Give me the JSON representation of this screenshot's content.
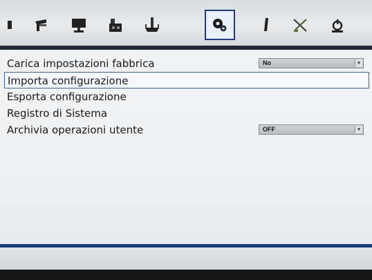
{
  "toolbar": {
    "icons": [
      {
        "name": "partial-icon"
      },
      {
        "name": "camera-icon"
      },
      {
        "name": "monitor-icon"
      },
      {
        "name": "network-icon"
      },
      {
        "name": "storage-icon"
      },
      {
        "name": "system-settings-icon",
        "active": true
      },
      {
        "name": "usb-icon"
      },
      {
        "name": "tools-icon"
      },
      {
        "name": "power-icon"
      }
    ],
    "active_color": "#1e3a7a",
    "rule_color": "#1f2733"
  },
  "menu": {
    "items": [
      {
        "label": "Carica impostazioni fabbrica",
        "dropdown": "No"
      },
      {
        "label": "Importa configurazione",
        "selected": true
      },
      {
        "label": "Esporta configurazione"
      },
      {
        "label": "Registro di Sistema"
      },
      {
        "label": "Archivia operazioni utente",
        "dropdown": "OFF"
      }
    ],
    "arrow_glyph": "▾"
  }
}
